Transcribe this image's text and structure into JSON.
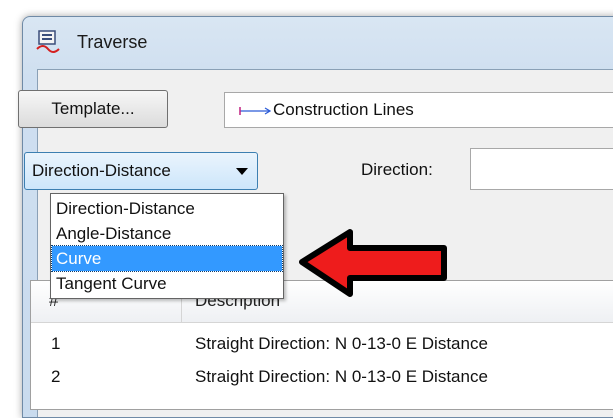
{
  "window": {
    "title": "Traverse",
    "icon": "traverse-app-icon"
  },
  "toolbar": {
    "template_button": "Template...",
    "style_value": "Construction Lines",
    "style_swatch_icon": "line-style-swatch-icon",
    "swatch_color": "#2a5bd7"
  },
  "entry": {
    "mode_selected": "Direction-Distance",
    "direction_label": "Direction:",
    "direction_value": ""
  },
  "dropdown": {
    "options": [
      {
        "label": "Direction-Distance",
        "selected": false
      },
      {
        "label": "Angle-Distance",
        "selected": false
      },
      {
        "label": "Curve",
        "selected": true
      },
      {
        "label": "Tangent Curve",
        "selected": false
      }
    ]
  },
  "grid": {
    "columns": [
      "#",
      "Description"
    ],
    "rows": [
      {
        "num": "1",
        "desc": "Straight  Direction: N 0-13-0 E  Distance"
      },
      {
        "num": "2",
        "desc": "Straight  Direction: N 0-13-0 E  Distance"
      }
    ]
  },
  "annotation": {
    "arrow_icon": "red-arrow-icon",
    "arrow_color": "#ee1c1c"
  }
}
